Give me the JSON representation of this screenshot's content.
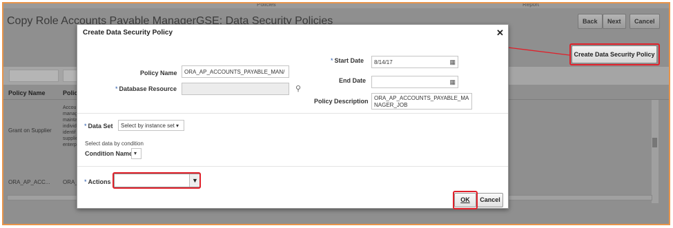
{
  "background": {
    "top_tabs": [
      "Policies",
      "Report"
    ],
    "page_title": "Copy Role Accounts Payable ManagerGSE: Data Security Policies",
    "buttons": {
      "back": "Back",
      "next": "Next",
      "cancel": "Cancel",
      "create_policy": "Create Data Security Policy"
    },
    "table": {
      "headers": [
        "Policy Name",
        "Policy"
      ],
      "rows": [
        {
          "name": "Grant on Supplier",
          "desc": "Accou manag mainta individ identif supplie enterp"
        },
        {
          "name": "ORA_AP_ACC...",
          "desc": "ORA_A"
        }
      ]
    }
  },
  "dialog": {
    "title": "Create Data Security Policy",
    "close_glyph": "✕",
    "policy_name_label": "Policy Name",
    "policy_name_value": "ORA_AP_ACCOUNTS_PAYABLE_MAN/",
    "database_resource_label": "Database Resource",
    "start_date_label": "Start Date",
    "start_date_value": "8/14/17",
    "end_date_label": "End Date",
    "end_date_value": "",
    "policy_description_label": "Policy Description",
    "policy_description_value": "ORA_AP_ACCOUNTS_PAYABLE_MANAGER_JOB",
    "data_set_label": "Data Set",
    "data_set_value": "Select by instance set",
    "select_by_condition_text": "Select data by condition",
    "condition_name_label": "Condition Name",
    "actions_label": "Actions",
    "ok_label": "OK",
    "cancel_label": "Cancel"
  },
  "colors": {
    "highlight": "#e0202a",
    "frame_border": "#e8944a",
    "required_asterisk": "#2255aa"
  }
}
